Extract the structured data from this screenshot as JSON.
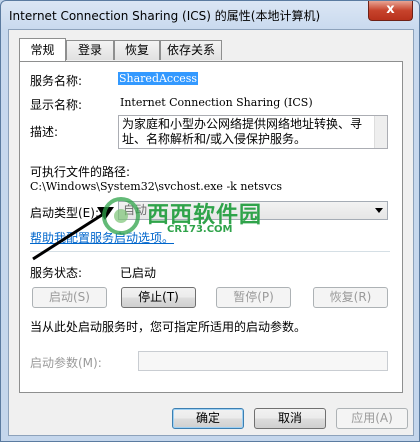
{
  "window": {
    "title": "Internet Connection Sharing (ICS) 的属性(本地计算机)",
    "close_label": "x"
  },
  "tabs": [
    {
      "label": "常规",
      "active": true
    },
    {
      "label": "登录",
      "active": false
    },
    {
      "label": "恢复",
      "active": false
    },
    {
      "label": "依存关系",
      "active": false
    }
  ],
  "general": {
    "service_name_label": "服务名称:",
    "service_name_value": "SharedAccess",
    "display_name_label": "显示名称:",
    "display_name_value": "Internet Connection Sharing (ICS)",
    "description_label": "描述:",
    "description_value": "为家庭和小型办公网络提供网络地址转换、寻址、名称解析和/或入侵保护服务。",
    "exe_path_label": "可执行文件的路径:",
    "exe_path_value": "C:\\Windows\\System32\\svchost.exe -k netsvcs",
    "startup_type_label": "启动类型(E):",
    "startup_type_value": "自动",
    "help_link": "帮助我配置服务启动选项。",
    "status_label": "服务状态:",
    "status_value": "已启动",
    "start_button": "启动(S)",
    "stop_button": "停止(T)",
    "pause_button": "暂停(P)",
    "resume_button": "恢复(R)",
    "hint_text": "当从此处启动服务时，您可指定所适用的启动参数。",
    "start_params_label": "启动参数(M):",
    "start_params_value": ""
  },
  "footer": {
    "ok_button": "确定",
    "cancel_button": "取消",
    "apply_button": "应用(A)"
  },
  "watermark": {
    "logo_text": "西西软件园",
    "url_text": "CR173.COM"
  },
  "colors": {
    "selection": "#3399ff",
    "link": "#0066cc",
    "watermark": "#2fa34a"
  }
}
